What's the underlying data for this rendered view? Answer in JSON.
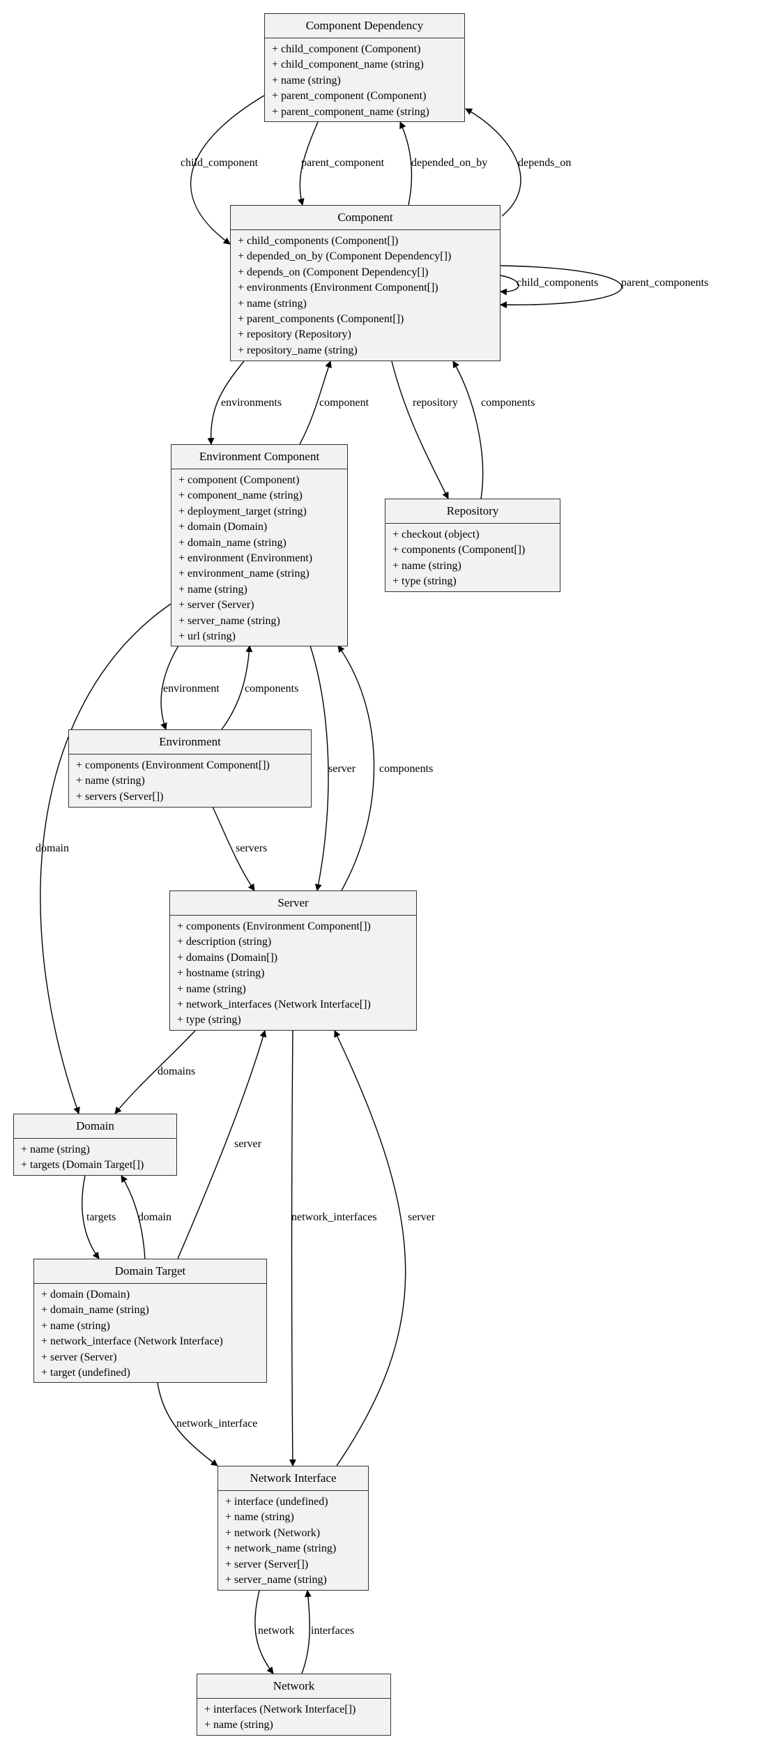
{
  "diagram": {
    "type": "class-diagram",
    "nodes": [
      {
        "id": "component-dependency",
        "title": "Component Dependency",
        "attributes": [
          "+ child_component (Component)",
          "+ child_component_name (string)",
          "+ name (string)",
          "+ parent_component (Component)",
          "+ parent_component_name (string)"
        ]
      },
      {
        "id": "component",
        "title": "Component",
        "attributes": [
          "+ child_components (Component[])",
          "+ depended_on_by (Component Dependency[])",
          "+ depends_on (Component Dependency[])",
          "+ environments (Environment Component[])",
          "+ name (string)",
          "+ parent_components (Component[])",
          "+ repository (Repository)",
          "+ repository_name (string)"
        ]
      },
      {
        "id": "environment-component",
        "title": "Environment Component",
        "attributes": [
          "+ component (Component)",
          "+ component_name (string)",
          "+ deployment_target (string)",
          "+ domain (Domain)",
          "+ domain_name (string)",
          "+ environment (Environment)",
          "+ environment_name (string)",
          "+ name (string)",
          "+ server (Server)",
          "+ server_name (string)",
          "+ url (string)"
        ]
      },
      {
        "id": "repository",
        "title": "Repository",
        "attributes": [
          "+ checkout (object)",
          "+ components (Component[])",
          "+ name (string)",
          "+ type (string)"
        ]
      },
      {
        "id": "environment",
        "title": "Environment",
        "attributes": [
          "+ components (Environment Component[])",
          "+ name (string)",
          "+ servers (Server[])"
        ]
      },
      {
        "id": "server",
        "title": "Server",
        "attributes": [
          "+ components (Environment Component[])",
          "+ description (string)",
          "+ domains (Domain[])",
          "+ hostname (string)",
          "+ name (string)",
          "+ network_interfaces (Network Interface[])",
          "+ type (string)"
        ]
      },
      {
        "id": "domain",
        "title": "Domain",
        "attributes": [
          "+ name (string)",
          "+ targets (Domain Target[])"
        ]
      },
      {
        "id": "domain-target",
        "title": "Domain Target",
        "attributes": [
          "+ domain (Domain)",
          "+ domain_name (string)",
          "+ name (string)",
          "+ network_interface (Network Interface)",
          "+ server (Server)",
          "+ target (undefined)"
        ]
      },
      {
        "id": "network-interface",
        "title": "Network Interface",
        "attributes": [
          "+ interface (undefined)",
          "+ name (string)",
          "+ network (Network)",
          "+ network_name (string)",
          "+ server (Server[])",
          "+ server_name (string)"
        ]
      },
      {
        "id": "network",
        "title": "Network",
        "attributes": [
          "+ interfaces (Network Interface[])",
          "+ name (string)"
        ]
      }
    ],
    "edges": [
      {
        "from": "component-dependency",
        "to": "component",
        "label": "child_component"
      },
      {
        "from": "component-dependency",
        "to": "component",
        "label": "parent_component"
      },
      {
        "from": "component",
        "to": "component-dependency",
        "label": "depended_on_by"
      },
      {
        "from": "component",
        "to": "component-dependency",
        "label": "depends_on"
      },
      {
        "from": "component",
        "to": "component",
        "label": "child_components"
      },
      {
        "from": "component",
        "to": "component",
        "label": "parent_components"
      },
      {
        "from": "component",
        "to": "environment-component",
        "label": "environments"
      },
      {
        "from": "environment-component",
        "to": "component",
        "label": "component"
      },
      {
        "from": "component",
        "to": "repository",
        "label": "repository"
      },
      {
        "from": "repository",
        "to": "component",
        "label": "components"
      },
      {
        "from": "environment-component",
        "to": "environment",
        "label": "environment"
      },
      {
        "from": "environment",
        "to": "environment-component",
        "label": "components"
      },
      {
        "from": "environment-component",
        "to": "server",
        "label": "server"
      },
      {
        "from": "server",
        "to": "environment-component",
        "label": "components"
      },
      {
        "from": "environment-component",
        "to": "domain",
        "label": "domain"
      },
      {
        "from": "environment",
        "to": "server",
        "label": "servers"
      },
      {
        "from": "server",
        "to": "domain",
        "label": "domains"
      },
      {
        "from": "domain-target",
        "to": "server",
        "label": "server"
      },
      {
        "from": "server",
        "to": "network-interface",
        "label": "network_interfaces"
      },
      {
        "from": "network-interface",
        "to": "server",
        "label": "server"
      },
      {
        "from": "domain",
        "to": "domain-target",
        "label": "targets"
      },
      {
        "from": "domain-target",
        "to": "domain",
        "label": "domain"
      },
      {
        "from": "domain-target",
        "to": "network-interface",
        "label": "network_interface"
      },
      {
        "from": "network-interface",
        "to": "network",
        "label": "network"
      },
      {
        "from": "network",
        "to": "network-interface",
        "label": "interfaces"
      }
    ]
  }
}
